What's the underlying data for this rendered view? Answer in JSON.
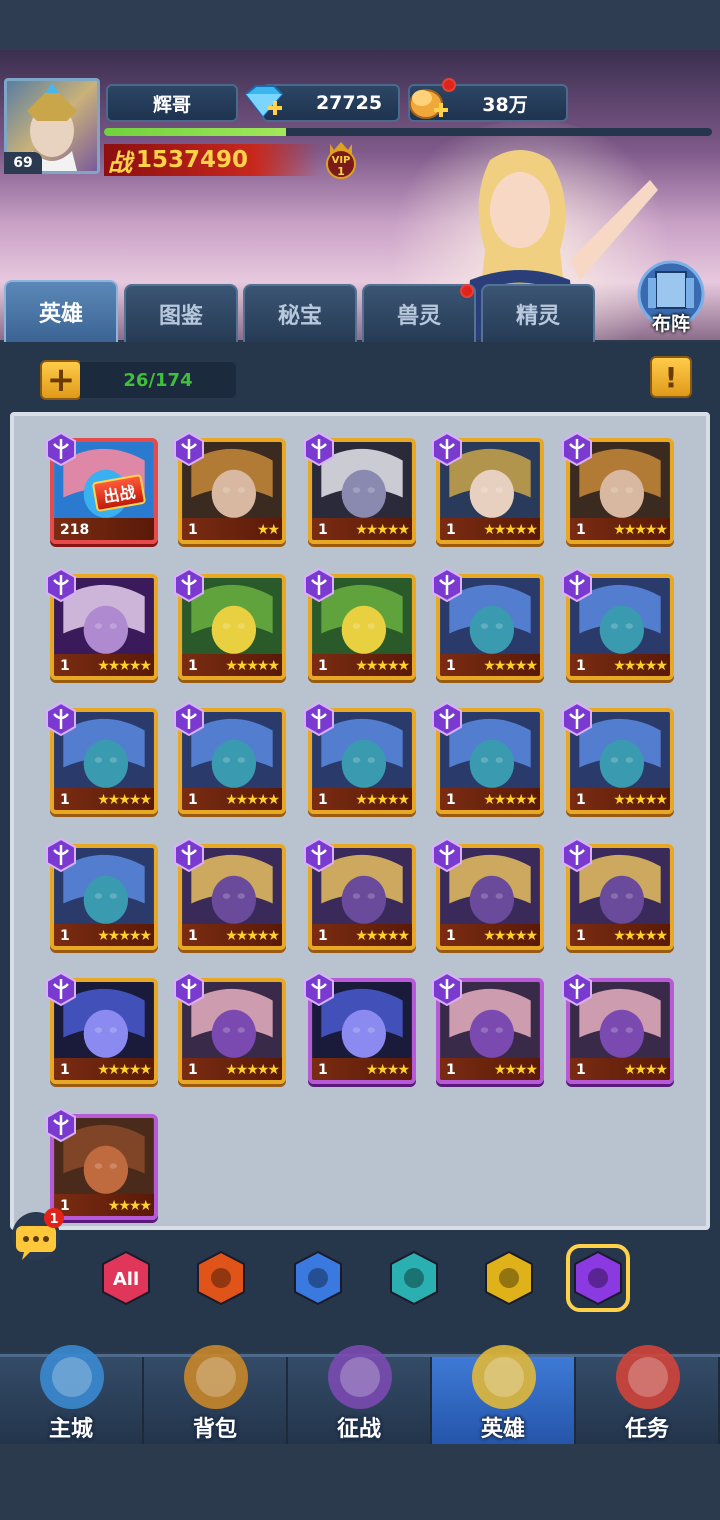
{
  "player": {
    "name": "辉哥",
    "level": "69",
    "gems": "27725",
    "gold": "38万",
    "power": "1537490",
    "power_prefix": "战",
    "vip_label": "VIP",
    "vip_level": "1",
    "exp_progress": 0.3
  },
  "tabs": [
    {
      "label": "英雄",
      "active": true
    },
    {
      "label": "图鉴",
      "active": false
    },
    {
      "label": "秘宝",
      "active": false
    },
    {
      "label": "兽灵",
      "active": false,
      "notify": true
    },
    {
      "label": "精灵",
      "active": false
    }
  ],
  "formation_label": "布阵",
  "hero_count": "26/174",
  "deployed_label": "出战",
  "heroes": [
    {
      "level": "218",
      "stars": 0,
      "rarity": "red",
      "portrait": "blue-elf",
      "deployed": true
    },
    {
      "level": "1",
      "stars": 2,
      "rarity": "gold",
      "portrait": "armored-knight"
    },
    {
      "level": "1",
      "stars": 5,
      "rarity": "gold",
      "portrait": "dark-elf"
    },
    {
      "level": "1",
      "stars": 5,
      "rarity": "gold",
      "portrait": "masked-sorceress"
    },
    {
      "level": "1",
      "stars": 5,
      "rarity": "gold",
      "portrait": "armored-knight"
    },
    {
      "level": "1",
      "stars": 5,
      "rarity": "gold",
      "portrait": "witch"
    },
    {
      "level": "1",
      "stars": 5,
      "rarity": "gold",
      "portrait": "frog"
    },
    {
      "level": "1",
      "stars": 5,
      "rarity": "gold",
      "portrait": "frog"
    },
    {
      "level": "1",
      "stars": 5,
      "rarity": "gold",
      "portrait": "medusa"
    },
    {
      "level": "1",
      "stars": 5,
      "rarity": "gold",
      "portrait": "medusa"
    },
    {
      "level": "1",
      "stars": 5,
      "rarity": "gold",
      "portrait": "medusa"
    },
    {
      "level": "1",
      "stars": 5,
      "rarity": "gold",
      "portrait": "medusa"
    },
    {
      "level": "1",
      "stars": 5,
      "rarity": "gold",
      "portrait": "medusa"
    },
    {
      "level": "1",
      "stars": 5,
      "rarity": "gold",
      "portrait": "medusa"
    },
    {
      "level": "1",
      "stars": 5,
      "rarity": "gold",
      "portrait": "medusa"
    },
    {
      "level": "1",
      "stars": 5,
      "rarity": "gold",
      "portrait": "medusa"
    },
    {
      "level": "1",
      "stars": 5,
      "rarity": "gold",
      "portrait": "masked-rogue"
    },
    {
      "level": "1",
      "stars": 5,
      "rarity": "gold",
      "portrait": "masked-rogue"
    },
    {
      "level": "1",
      "stars": 5,
      "rarity": "gold",
      "portrait": "masked-rogue"
    },
    {
      "level": "1",
      "stars": 5,
      "rarity": "gold",
      "portrait": "masked-rogue"
    },
    {
      "level": "1",
      "stars": 5,
      "rarity": "gold",
      "portrait": "shadow-knight"
    },
    {
      "level": "1",
      "stars": 5,
      "rarity": "gold",
      "portrait": "crowned-mage"
    },
    {
      "level": "1",
      "stars": 4,
      "rarity": "purple",
      "portrait": "shadow-knight"
    },
    {
      "level": "1",
      "stars": 4,
      "rarity": "purple",
      "portrait": "crowned-mage"
    },
    {
      "level": "1",
      "stars": 4,
      "rarity": "purple",
      "portrait": "crowned-mage"
    },
    {
      "level": "1",
      "stars": 4,
      "rarity": "purple",
      "portrait": "bear"
    }
  ],
  "filters": [
    {
      "label": "All",
      "icon": "all-filter-icon",
      "color": "#e0365a"
    },
    {
      "label": "",
      "icon": "warrior-filter-icon",
      "color": "#e0541a"
    },
    {
      "label": "",
      "icon": "support-filter-icon",
      "color": "#3a7ae0"
    },
    {
      "label": "",
      "icon": "undead-filter-icon",
      "color": "#2ab0b0"
    },
    {
      "label": "",
      "icon": "wind-filter-icon",
      "color": "#e0b21a"
    },
    {
      "label": "",
      "icon": "arcane-filter-icon",
      "color": "#8a3ae0",
      "active": true
    }
  ],
  "chat_badge": "1",
  "nav": [
    {
      "label": "主城",
      "icon": "castle-icon"
    },
    {
      "label": "背包",
      "icon": "chest-icon"
    },
    {
      "label": "征战",
      "icon": "portal-icon"
    },
    {
      "label": "英雄",
      "icon": "hero-helmet-icon",
      "active": true
    },
    {
      "label": "任务",
      "icon": "scroll-icon"
    }
  ],
  "colors": {
    "gold_frame": "#e8a824",
    "purple_frame": "#b85ad8",
    "exp_green": "#6fd23c",
    "count_green": "#3fbf3a",
    "nav_active": "#3e7ad6"
  }
}
